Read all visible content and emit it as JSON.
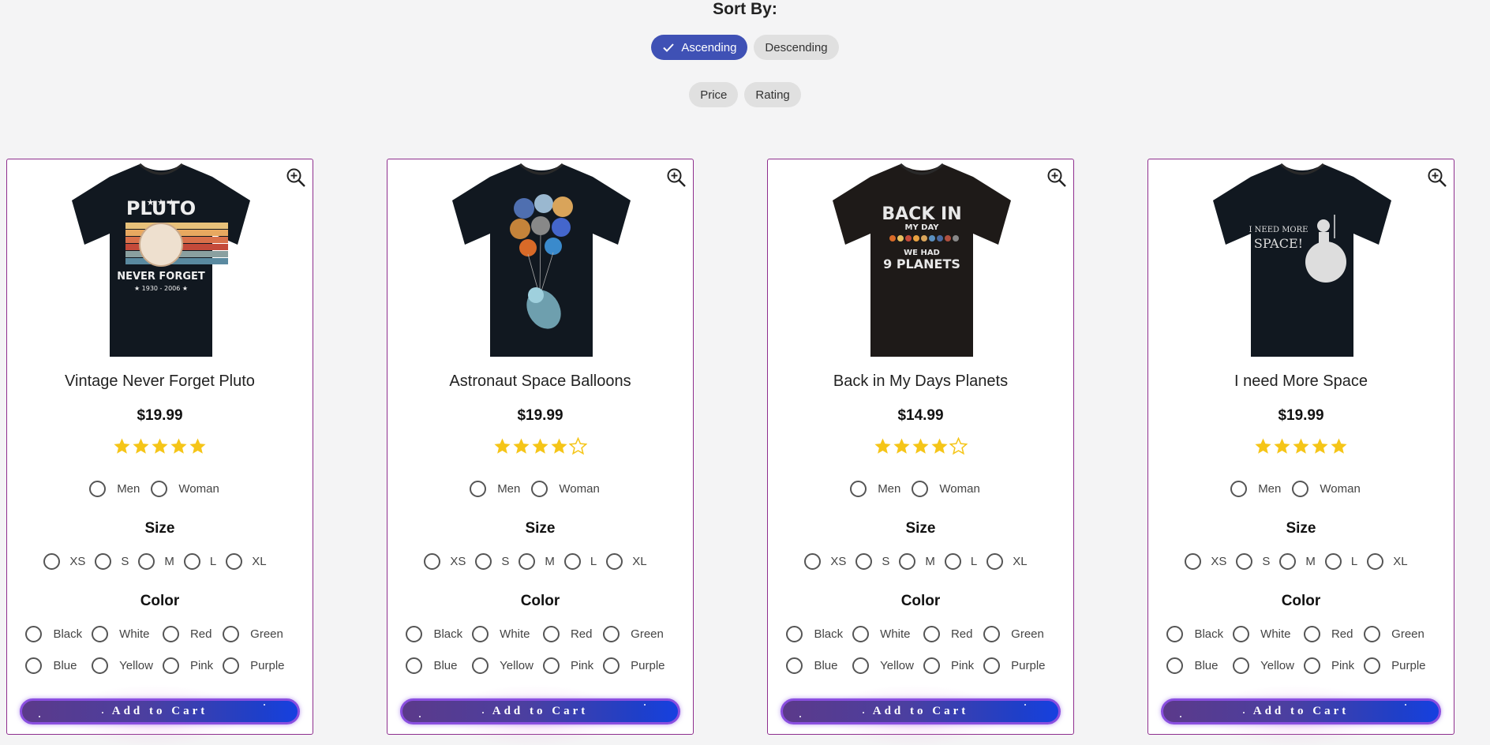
{
  "sort": {
    "title": "Sort By:",
    "order_options": [
      {
        "label": "Ascending",
        "selected": true
      },
      {
        "label": "Descending",
        "selected": false
      }
    ],
    "field_options": [
      {
        "label": "Price"
      },
      {
        "label": "Rating"
      }
    ]
  },
  "colors": {
    "accent": "#3f51b5",
    "card_border": "#8e2e8e",
    "star": "#f5c518",
    "cart_gradient_start": "#5b3a8a",
    "cart_gradient_end": "#1640e0"
  },
  "labels": {
    "gender": [
      "Men",
      "Woman"
    ],
    "size_title": "Size",
    "sizes": [
      "XS",
      "S",
      "M",
      "L",
      "XL"
    ],
    "color_title": "Color",
    "color_options_row1": [
      "Black",
      "White",
      "Red",
      "Green"
    ],
    "color_options_row2": [
      "Blue",
      "Yellow",
      "Pink",
      "Purple"
    ],
    "add_to_cart": "Add to Cart"
  },
  "products": [
    {
      "name": "Vintage Never Forget Pluto",
      "price": "$19.99",
      "rating": 5,
      "shirt_text": [
        "★ ★ ★",
        "PLUTO",
        "NEVER FORGET",
        "★ 1930 - 2006 ★"
      ],
      "image_icon": "pluto-tshirt"
    },
    {
      "name": "Astronaut Space Balloons",
      "price": "$19.99",
      "rating": 4,
      "shirt_text": [],
      "image_icon": "astronaut-balloons-tshirt"
    },
    {
      "name": "Back in My Days Planets",
      "price": "$14.99",
      "rating": 4,
      "shirt_text": [
        "BACK IN",
        "MY DAY",
        "WE HAD",
        "9 PLANETS"
      ],
      "image_icon": "planets-tshirt"
    },
    {
      "name": "I need More Space",
      "price": "$19.99",
      "rating": 5,
      "shirt_text": [
        "I NEED MORE",
        "SPACE!"
      ],
      "image_icon": "astronaut-moon-tshirt"
    }
  ]
}
